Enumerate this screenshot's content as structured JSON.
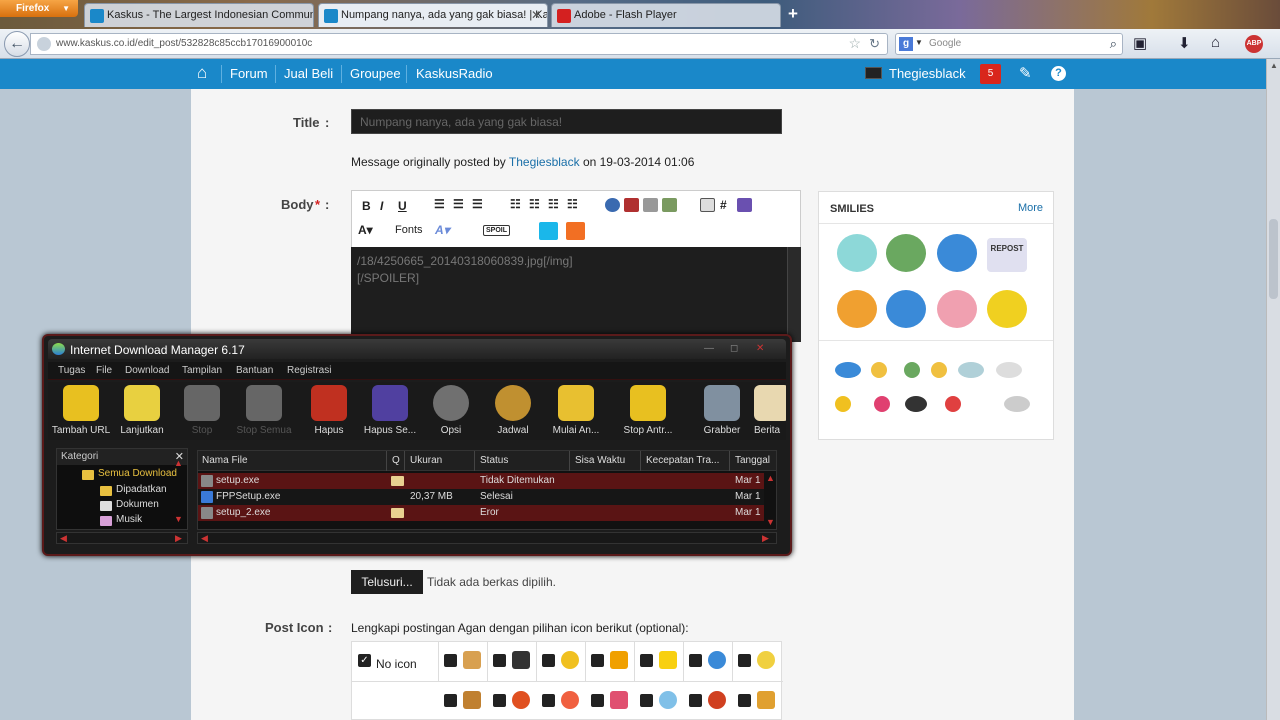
{
  "browser": {
    "menu_button": "Firefox",
    "tabs": [
      {
        "title": "Kaskus - The Largest Indonesian Community",
        "favicon_color": "#1a88c9",
        "active": false
      },
      {
        "title": "Numpang nanya, ada yang gak biasa! | Kask...",
        "favicon_color": "#1a88c9",
        "active": true
      },
      {
        "title": "Adobe - Flash Player",
        "favicon_color": "#d42020",
        "active": false
      }
    ],
    "url": "www.kaskus.co.id/edit_post/532828c85ccb17016900010c",
    "search_engine": "g-icon",
    "search_placeholder": "Google",
    "addon_badge": "ABP"
  },
  "kaskus_nav": {
    "items": [
      "Forum",
      "Jual Beli",
      "Groupee",
      "KaskusRadio"
    ],
    "username": "Thegiesblack",
    "notification_count": "5",
    "accent": "#1a88c9"
  },
  "form": {
    "title_label": "Title",
    "title_colon": ":",
    "title_value": "Numpang nanya, ada yang gak biasa!",
    "msg_prefix": "Message originally posted by",
    "msg_author": "Thegiesblack",
    "msg_on": "on 19-03-2014 01:06",
    "body_label": "Body",
    "body_required": "*",
    "body_colon": ":",
    "toolbar_fonts": "Fonts",
    "toolbar_spoiler": "SPOIL",
    "toolbar_hash": "#",
    "toolbar_bold": "B",
    "toolbar_italic": "I",
    "toolbar_underline": "U",
    "body_line1": "/18/4250665_20140318060839.jpg[/img]",
    "body_line2": "[/SPOILER]",
    "browse_button": "Telusuri...",
    "no_file": "Tidak ada berkas dipilih.",
    "post_icon_label": "Post Icon",
    "post_icon_colon": ":",
    "post_icon_desc": "Lengkapi postingan Agan dengan pilihan icon berikut (optional):",
    "no_icon": "No icon"
  },
  "smilies": {
    "title": "SMILIES",
    "more": "More",
    "repost_text": "REPOST"
  },
  "idm": {
    "title": "Internet Download Manager 6.17",
    "menu": [
      "Tugas",
      "File",
      "Download",
      "Tampilan",
      "Bantuan",
      "Registrasi"
    ],
    "tools": [
      {
        "label": "Tambah URL",
        "enabled": true,
        "color": "#e8c020"
      },
      {
        "label": "Lanjutkan",
        "enabled": true,
        "color": "#e8d040"
      },
      {
        "label": "Stop",
        "enabled": false,
        "color": "#888"
      },
      {
        "label": "Stop Semua",
        "enabled": false,
        "color": "#888"
      },
      {
        "label": "Hapus",
        "enabled": true,
        "color": "#c03020"
      },
      {
        "label": "Hapus Se...",
        "enabled": true,
        "color": "#5040a0"
      },
      {
        "label": "Opsi",
        "enabled": true,
        "color": "#707070"
      },
      {
        "label": "Jadwal",
        "enabled": true,
        "color": "#c09030"
      },
      {
        "label": "Mulai An...",
        "enabled": true,
        "color": "#e8c030"
      },
      {
        "label": "Stop Antr...",
        "enabled": true,
        "color": "#e8c020"
      },
      {
        "label": "Grabber",
        "enabled": true,
        "color": "#8090a0"
      },
      {
        "label": "Berita",
        "enabled": true,
        "color": "#e8d8b0"
      }
    ],
    "category_header": "Kategori",
    "categories": [
      "Semua Download",
      "Dipadatkan",
      "Dokumen",
      "Musik"
    ],
    "columns": [
      "Nama File",
      "Q",
      "Ukuran",
      "Status",
      "Sisa Waktu",
      "Kecepatan Tra...",
      "Tanggal"
    ],
    "rows": [
      {
        "name": "setup.exe",
        "size": "",
        "status": "Tidak Ditemukan",
        "date": "Mar 1",
        "highlight": true
      },
      {
        "name": "FPPSetup.exe",
        "size": "20,37 MB",
        "status": "Selesai",
        "date": "Mar 1",
        "highlight": false
      },
      {
        "name": "setup_2.exe",
        "size": "",
        "status": "Eror",
        "date": "Mar 1",
        "highlight": true
      }
    ]
  }
}
